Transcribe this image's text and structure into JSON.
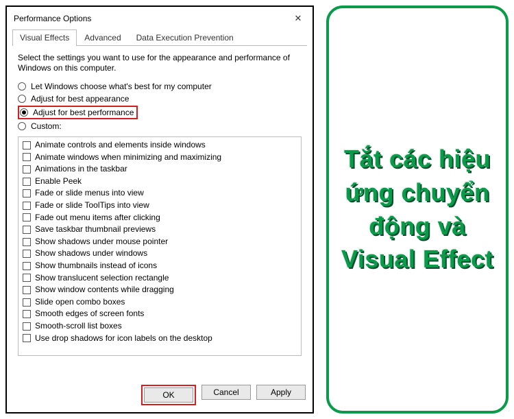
{
  "dialog": {
    "title": "Performance Options",
    "close": "✕",
    "tabs": [
      "Visual Effects",
      "Advanced",
      "Data Execution Prevention"
    ],
    "active_tab": 0,
    "description": "Select the settings you want to use for the appearance and performance of Windows on this computer.",
    "radios": [
      {
        "label": "Let Windows choose what's best for my computer",
        "checked": false,
        "highlight": false
      },
      {
        "label": "Adjust for best appearance",
        "checked": false,
        "highlight": false
      },
      {
        "label": "Adjust for best performance",
        "checked": true,
        "highlight": true
      },
      {
        "label": "Custom:",
        "checked": false,
        "highlight": false
      }
    ],
    "checkbox_items": [
      "Animate controls and elements inside windows",
      "Animate windows when minimizing and maximizing",
      "Animations in the taskbar",
      "Enable Peek",
      "Fade or slide menus into view",
      "Fade or slide ToolTips into view",
      "Fade out menu items after clicking",
      "Save taskbar thumbnail previews",
      "Show shadows under mouse pointer",
      "Show shadows under windows",
      "Show thumbnails instead of icons",
      "Show translucent selection rectangle",
      "Show window contents while dragging",
      "Slide open combo boxes",
      "Smooth edges of screen fonts",
      "Smooth-scroll list boxes",
      "Use drop shadows for icon labels on the desktop"
    ],
    "buttons": {
      "ok": "OK",
      "cancel": "Cancel",
      "apply": "Apply"
    }
  },
  "side_caption": "Tắt các hiệu ứng chuyển động và Visual Effect"
}
